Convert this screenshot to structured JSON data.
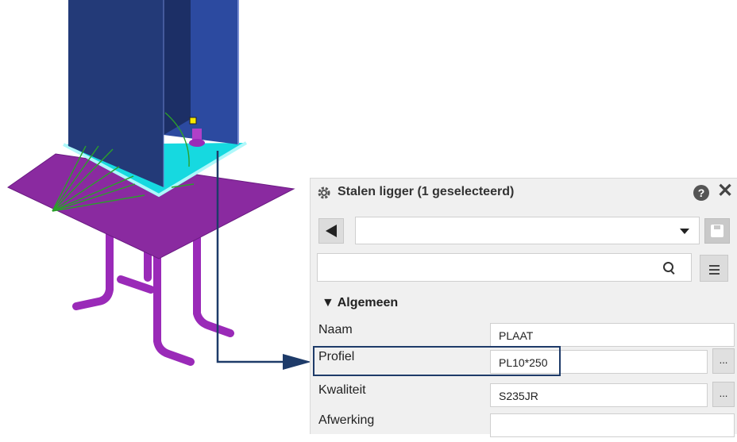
{
  "colors": {
    "column": "#233a78",
    "base_plate": "#8a2aa0",
    "stiffener_plate": "#16d9e0",
    "anchor": "#9a2ab8",
    "callout": "#1e3b69"
  },
  "panel": {
    "title": "Stalen ligger (1 geselecteerd)",
    "help_label": "?",
    "close_label": "✕",
    "icons": {
      "settings": "gear-icon",
      "back": "back-arrow-icon",
      "dropdown": "chevron-down-icon",
      "save": "save-icon",
      "search": "search-icon",
      "menu": "menu-icon"
    },
    "preset_value": "",
    "search_value": "",
    "section_label": "▼ Algemeen",
    "properties": [
      {
        "label": "Naam",
        "value": "PLAAT"
      },
      {
        "label": "Profiel",
        "value": "PL10*250",
        "browse": "..."
      },
      {
        "label": "Kwaliteit",
        "value": "S235JR",
        "browse": "..."
      },
      {
        "label": "Afwerking",
        "value": ""
      }
    ]
  }
}
